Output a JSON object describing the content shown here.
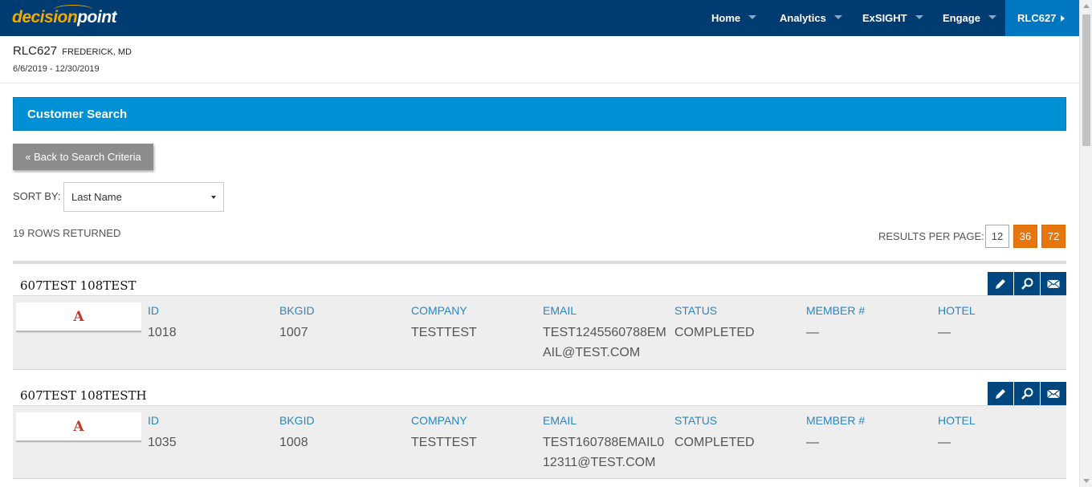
{
  "nav": {
    "logo_part1": "decision",
    "logo_part2": "point",
    "items": [
      {
        "label": "Home"
      },
      {
        "label": "Analytics"
      },
      {
        "label": "ExSIGHT"
      },
      {
        "label": "Engage"
      }
    ],
    "account": "RLC627"
  },
  "location": {
    "code": "RLC627",
    "city": "FREDERICK, MD",
    "dates": "6/6/2019 - 12/30/2019"
  },
  "panel": {
    "title": "Customer Search",
    "back_button": "« Back to Search Criteria"
  },
  "sort": {
    "label": "SORT BY:",
    "value": "Last Name"
  },
  "results_info": {
    "rows_returned": "19 ROWS RETURNED",
    "per_page_label": "RESULTS PER PAGE:",
    "per_page_options": [
      "12",
      "36",
      "72"
    ],
    "per_page_selected": "12"
  },
  "colors": {
    "nav_bg": "#003c71",
    "accent_blue": "#0090d6",
    "orange": "#e8760f",
    "action_btn": "#00467f"
  },
  "field_labels": {
    "id": "ID",
    "bkgid": "BKGID",
    "company": "COMPANY",
    "email": "EMAIL",
    "status": "STATUS",
    "member": "MEMBER #",
    "hotel": "HOTEL"
  },
  "results": [
    {
      "name": "607TEST 108TEST",
      "avatar": "A",
      "id": "1018",
      "bkgid": "1007",
      "company": "TESTTEST",
      "email": "TEST1245560788EMAIL@TEST.COM",
      "status": "COMPLETED",
      "member": "—",
      "hotel": "—"
    },
    {
      "name": "607TEST 108TESTH",
      "avatar": "A",
      "id": "1035",
      "bkgid": "1008",
      "company": "TESTTEST",
      "email": "TEST160788EMAIL012311@TEST.COM",
      "status": "COMPLETED",
      "member": "—",
      "hotel": "—"
    }
  ],
  "icons": {
    "edit": "pencil-icon",
    "search": "magnifier-icon",
    "mail": "envelope-icon"
  }
}
